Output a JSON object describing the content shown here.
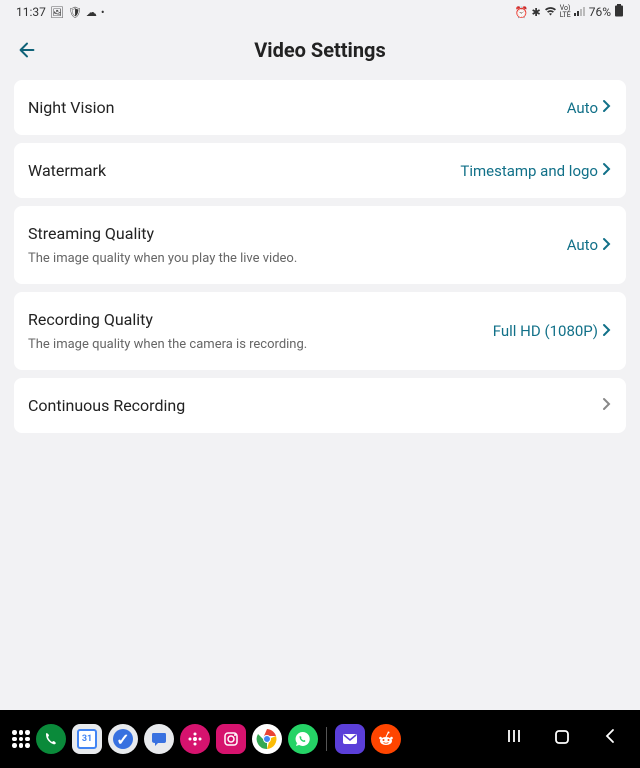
{
  "status": {
    "time": "11:37",
    "battery": "76%"
  },
  "header": {
    "title": "Video Settings"
  },
  "settings": [
    {
      "label": "Night Vision",
      "value": "Auto",
      "sublabel": null
    },
    {
      "label": "Watermark",
      "value": "Timestamp and logo",
      "sublabel": null
    },
    {
      "label": "Streaming Quality",
      "value": "Auto",
      "sublabel": "The image quality when you play the live video."
    },
    {
      "label": "Recording Quality",
      "value": "Full HD (1080P)",
      "sublabel": "The image quality when the camera is recording."
    },
    {
      "label": "Continuous Recording",
      "value": null,
      "sublabel": null
    }
  ]
}
